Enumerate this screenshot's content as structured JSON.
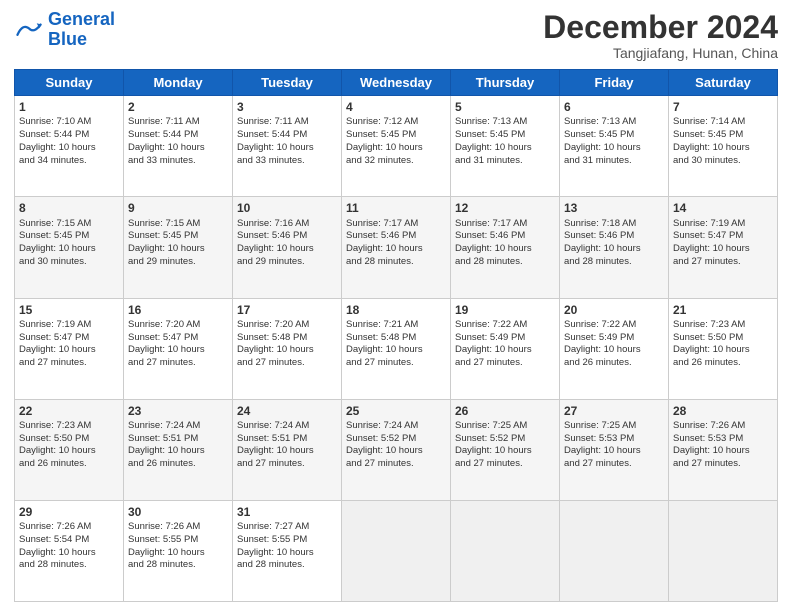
{
  "header": {
    "logo_line1": "General",
    "logo_line2": "Blue",
    "month_title": "December 2024",
    "location": "Tangjiafang, Hunan, China"
  },
  "days_of_week": [
    "Sunday",
    "Monday",
    "Tuesday",
    "Wednesday",
    "Thursday",
    "Friday",
    "Saturday"
  ],
  "weeks": [
    [
      {
        "day": "1",
        "lines": [
          "Sunrise: 7:10 AM",
          "Sunset: 5:44 PM",
          "Daylight: 10 hours",
          "and 34 minutes."
        ]
      },
      {
        "day": "2",
        "lines": [
          "Sunrise: 7:11 AM",
          "Sunset: 5:44 PM",
          "Daylight: 10 hours",
          "and 33 minutes."
        ]
      },
      {
        "day": "3",
        "lines": [
          "Sunrise: 7:11 AM",
          "Sunset: 5:44 PM",
          "Daylight: 10 hours",
          "and 33 minutes."
        ]
      },
      {
        "day": "4",
        "lines": [
          "Sunrise: 7:12 AM",
          "Sunset: 5:45 PM",
          "Daylight: 10 hours",
          "and 32 minutes."
        ]
      },
      {
        "day": "5",
        "lines": [
          "Sunrise: 7:13 AM",
          "Sunset: 5:45 PM",
          "Daylight: 10 hours",
          "and 31 minutes."
        ]
      },
      {
        "day": "6",
        "lines": [
          "Sunrise: 7:13 AM",
          "Sunset: 5:45 PM",
          "Daylight: 10 hours",
          "and 31 minutes."
        ]
      },
      {
        "day": "7",
        "lines": [
          "Sunrise: 7:14 AM",
          "Sunset: 5:45 PM",
          "Daylight: 10 hours",
          "and 30 minutes."
        ]
      }
    ],
    [
      {
        "day": "8",
        "lines": [
          "Sunrise: 7:15 AM",
          "Sunset: 5:45 PM",
          "Daylight: 10 hours",
          "and 30 minutes."
        ]
      },
      {
        "day": "9",
        "lines": [
          "Sunrise: 7:15 AM",
          "Sunset: 5:45 PM",
          "Daylight: 10 hours",
          "and 29 minutes."
        ]
      },
      {
        "day": "10",
        "lines": [
          "Sunrise: 7:16 AM",
          "Sunset: 5:46 PM",
          "Daylight: 10 hours",
          "and 29 minutes."
        ]
      },
      {
        "day": "11",
        "lines": [
          "Sunrise: 7:17 AM",
          "Sunset: 5:46 PM",
          "Daylight: 10 hours",
          "and 28 minutes."
        ]
      },
      {
        "day": "12",
        "lines": [
          "Sunrise: 7:17 AM",
          "Sunset: 5:46 PM",
          "Daylight: 10 hours",
          "and 28 minutes."
        ]
      },
      {
        "day": "13",
        "lines": [
          "Sunrise: 7:18 AM",
          "Sunset: 5:46 PM",
          "Daylight: 10 hours",
          "and 28 minutes."
        ]
      },
      {
        "day": "14",
        "lines": [
          "Sunrise: 7:19 AM",
          "Sunset: 5:47 PM",
          "Daylight: 10 hours",
          "and 27 minutes."
        ]
      }
    ],
    [
      {
        "day": "15",
        "lines": [
          "Sunrise: 7:19 AM",
          "Sunset: 5:47 PM",
          "Daylight: 10 hours",
          "and 27 minutes."
        ]
      },
      {
        "day": "16",
        "lines": [
          "Sunrise: 7:20 AM",
          "Sunset: 5:47 PM",
          "Daylight: 10 hours",
          "and 27 minutes."
        ]
      },
      {
        "day": "17",
        "lines": [
          "Sunrise: 7:20 AM",
          "Sunset: 5:48 PM",
          "Daylight: 10 hours",
          "and 27 minutes."
        ]
      },
      {
        "day": "18",
        "lines": [
          "Sunrise: 7:21 AM",
          "Sunset: 5:48 PM",
          "Daylight: 10 hours",
          "and 27 minutes."
        ]
      },
      {
        "day": "19",
        "lines": [
          "Sunrise: 7:22 AM",
          "Sunset: 5:49 PM",
          "Daylight: 10 hours",
          "and 27 minutes."
        ]
      },
      {
        "day": "20",
        "lines": [
          "Sunrise: 7:22 AM",
          "Sunset: 5:49 PM",
          "Daylight: 10 hours",
          "and 26 minutes."
        ]
      },
      {
        "day": "21",
        "lines": [
          "Sunrise: 7:23 AM",
          "Sunset: 5:50 PM",
          "Daylight: 10 hours",
          "and 26 minutes."
        ]
      }
    ],
    [
      {
        "day": "22",
        "lines": [
          "Sunrise: 7:23 AM",
          "Sunset: 5:50 PM",
          "Daylight: 10 hours",
          "and 26 minutes."
        ]
      },
      {
        "day": "23",
        "lines": [
          "Sunrise: 7:24 AM",
          "Sunset: 5:51 PM",
          "Daylight: 10 hours",
          "and 26 minutes."
        ]
      },
      {
        "day": "24",
        "lines": [
          "Sunrise: 7:24 AM",
          "Sunset: 5:51 PM",
          "Daylight: 10 hours",
          "and 27 minutes."
        ]
      },
      {
        "day": "25",
        "lines": [
          "Sunrise: 7:24 AM",
          "Sunset: 5:52 PM",
          "Daylight: 10 hours",
          "and 27 minutes."
        ]
      },
      {
        "day": "26",
        "lines": [
          "Sunrise: 7:25 AM",
          "Sunset: 5:52 PM",
          "Daylight: 10 hours",
          "and 27 minutes."
        ]
      },
      {
        "day": "27",
        "lines": [
          "Sunrise: 7:25 AM",
          "Sunset: 5:53 PM",
          "Daylight: 10 hours",
          "and 27 minutes."
        ]
      },
      {
        "day": "28",
        "lines": [
          "Sunrise: 7:26 AM",
          "Sunset: 5:53 PM",
          "Daylight: 10 hours",
          "and 27 minutes."
        ]
      }
    ],
    [
      {
        "day": "29",
        "lines": [
          "Sunrise: 7:26 AM",
          "Sunset: 5:54 PM",
          "Daylight: 10 hours",
          "and 28 minutes."
        ]
      },
      {
        "day": "30",
        "lines": [
          "Sunrise: 7:26 AM",
          "Sunset: 5:55 PM",
          "Daylight: 10 hours",
          "and 28 minutes."
        ]
      },
      {
        "day": "31",
        "lines": [
          "Sunrise: 7:27 AM",
          "Sunset: 5:55 PM",
          "Daylight: 10 hours",
          "and 28 minutes."
        ]
      },
      null,
      null,
      null,
      null
    ]
  ]
}
